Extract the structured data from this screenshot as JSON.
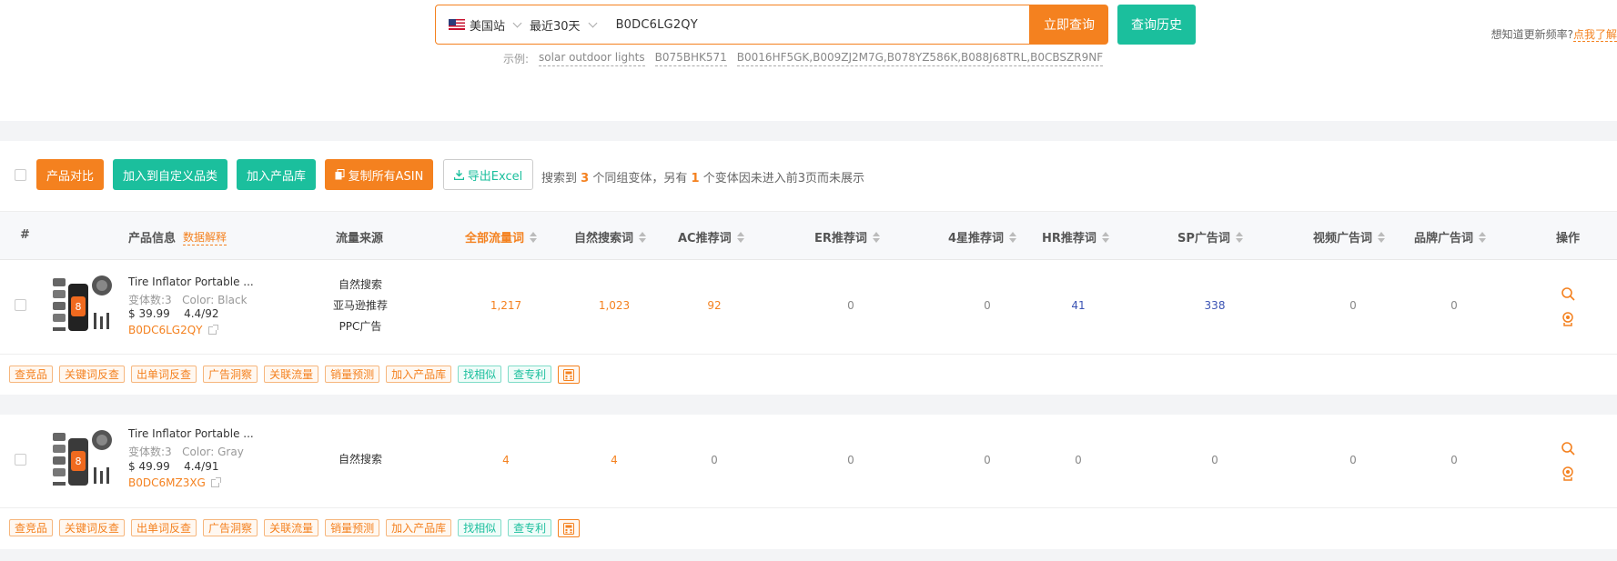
{
  "search": {
    "station": "美国站",
    "period": "最近30天",
    "query": "B0DC6LG2QY",
    "submit_label": "立即查询",
    "history_label": "查询历史",
    "examples_label": "示例:",
    "examples": [
      "solar outdoor lights",
      "B075BHK571",
      "B0016HF5GK,B009ZJ2M7G,B078YZ586K,B088J68TRL,B0CBSZR9NF"
    ],
    "freq_prefix": "想知道更新频率?",
    "freq_link": "点我了解"
  },
  "toolbar": {
    "compare": "产品对比",
    "add_custom_category": "加入到自定义品类",
    "add_library": "加入产品库",
    "copy_asin": "复制所有ASIN",
    "export_excel": "导出Excel",
    "summary_pre": "搜索到",
    "summary_count": "3",
    "summary_mid": "个同组变体，另有",
    "summary_other": "1",
    "summary_post": "个变体因未进入前3页而未展示"
  },
  "columns": {
    "index": "#",
    "product_info": "产品信息",
    "data_explain": "数据解释",
    "traffic_source": "流量来源",
    "all_keywords": "全部流量词",
    "organic": "自然搜索词",
    "ac": "AC推荐词",
    "er": "ER推荐词",
    "star4": "4星推荐词",
    "hr": "HR推荐词",
    "sp": "SP广告词",
    "video_ad": "视频广告词",
    "brand_ad": "品牌广告词",
    "action": "操作"
  },
  "rows": [
    {
      "name": "Tire Inflator Portable ...",
      "variants": "变体数:3",
      "color": "Color: Black",
      "price": "$ 39.99",
      "rating": "4.4/92",
      "asin": "B0DC6LG2QY",
      "sources": [
        "自然搜索",
        "亚马逊推荐",
        "PPC广告"
      ],
      "all": "1,217",
      "organic": "1,023",
      "ac": "92",
      "er": "0",
      "star4": "0",
      "hr": "41",
      "sp": "338",
      "video": "0",
      "brand": "0"
    },
    {
      "name": "Tire Inflator Portable ...",
      "variants": "变体数:3",
      "color": "Color: Gray",
      "price": "$ 49.99",
      "rating": "4.4/91",
      "asin": "B0DC6MZ3XG",
      "sources": [
        "自然搜索"
      ],
      "all": "4",
      "organic": "4",
      "ac": "0",
      "er": "0",
      "star4": "0",
      "hr": "0",
      "sp": "0",
      "video": "0",
      "brand": "0"
    }
  ],
  "tags": [
    "查竞品",
    "关键词反查",
    "出单词反查",
    "广告洞察",
    "关联流量",
    "销量预测",
    "加入产品库",
    "找相似",
    "查专利"
  ],
  "colors": {
    "orange": "#f4811f",
    "green": "#1bbf9d",
    "blue": "#3b53b4"
  }
}
